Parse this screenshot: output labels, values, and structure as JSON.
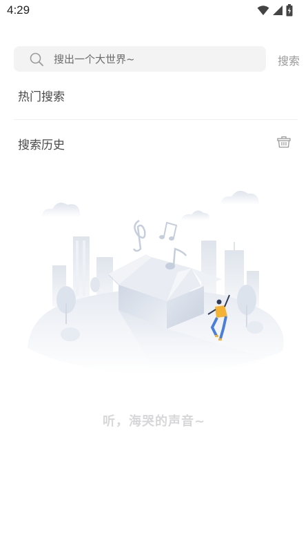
{
  "status_bar": {
    "time": "4:29",
    "icons": [
      "wifi-icon",
      "signal-icon",
      "battery-icon"
    ]
  },
  "search": {
    "placeholder": "搜出一个大世界~",
    "value": "",
    "button_label": "搜索"
  },
  "hot_search": {
    "title": "热门搜索"
  },
  "history": {
    "title": "搜索历史",
    "clear_icon": "trash-basket-icon"
  },
  "empty_state": {
    "illustration": "music-box-city-illustration",
    "text": "听，海哭的声音~"
  },
  "colors": {
    "search_bg": "#f3f3f4",
    "accent_figure": "#f5b335",
    "figure_pants": "#4a7fd8",
    "empty_text": "#d7d7d9"
  }
}
